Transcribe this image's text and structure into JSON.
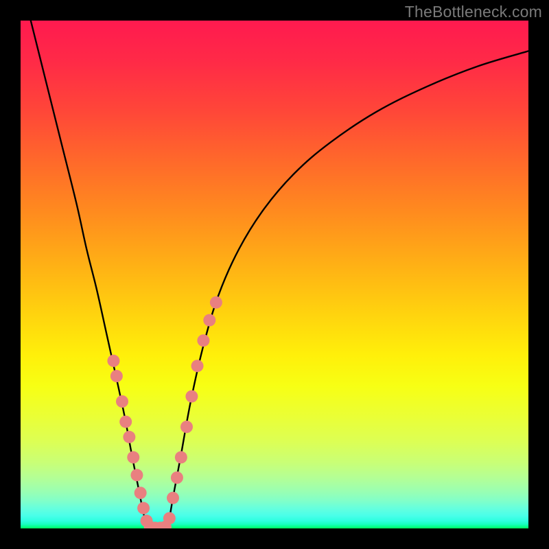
{
  "watermark": "TheBottleneck.com",
  "colors": {
    "background": "#000000",
    "curve": "#000000",
    "dot": "#e98080",
    "gradient_top": "#ff1a4f",
    "gradient_bottom": "#00ff5e"
  },
  "chart_data": {
    "type": "line",
    "title": "",
    "xlabel": "",
    "ylabel": "",
    "xlim": [
      0,
      100
    ],
    "ylim": [
      0,
      100
    ],
    "series": [
      {
        "name": "left-branch",
        "x": [
          2,
          5,
          8,
          11,
          13,
          15,
          17,
          19,
          20.5,
          22,
          23.2,
          24.2,
          25
        ],
        "y": [
          100,
          88,
          76,
          64,
          55,
          47,
          38,
          29,
          22,
          14,
          8,
          3,
          0
        ]
      },
      {
        "name": "valley",
        "x": [
          25,
          26,
          27,
          28,
          29
        ],
        "y": [
          0,
          0,
          0,
          0,
          0
        ]
      },
      {
        "name": "right-branch",
        "x": [
          29,
          30,
          31.5,
          33.5,
          36,
          39,
          43,
          48,
          54,
          61,
          70,
          80,
          90,
          100
        ],
        "y": [
          0,
          6,
          14,
          25,
          36,
          46,
          55,
          63,
          70,
          76,
          82,
          87,
          91,
          94
        ]
      }
    ],
    "dots": {
      "left_cluster_x": [
        18.3,
        18.9,
        20.0,
        20.7,
        21.4,
        22.2,
        22.9,
        23.6,
        24.2,
        24.8
      ],
      "left_cluster_y": [
        33,
        30,
        25,
        21,
        18,
        14,
        10.5,
        7,
        4,
        1.5
      ],
      "valley_x": [
        25.5,
        26.5,
        27.5,
        28.5
      ],
      "valley_y": [
        0.3,
        0.1,
        0.1,
        0.3
      ],
      "right_cluster_x": [
        29.3,
        30.0,
        30.8,
        31.6,
        32.7,
        33.7,
        34.8,
        36.0,
        37.2,
        38.5
      ],
      "right_cluster_y": [
        2,
        6,
        10,
        14,
        20,
        26,
        32,
        37,
        41,
        44.5
      ]
    },
    "dot_radius_px": 9
  }
}
